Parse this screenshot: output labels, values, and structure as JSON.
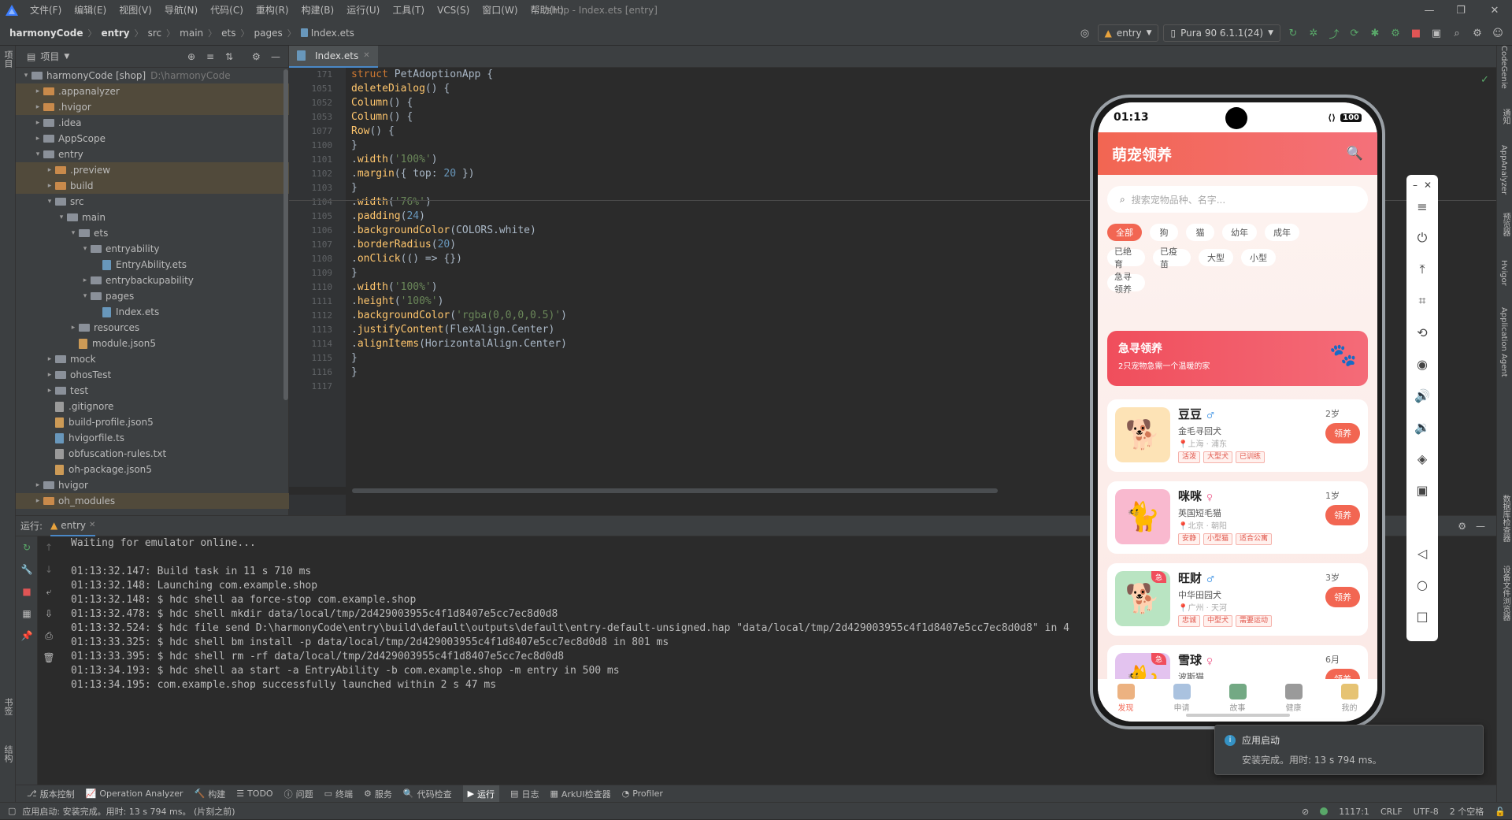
{
  "menu": [
    "文件(F)",
    "编辑(E)",
    "视图(V)",
    "导航(N)",
    "代码(C)",
    "重构(R)",
    "构建(B)",
    "运行(U)",
    "工具(T)",
    "VCS(S)",
    "窗口(W)",
    "帮助(H)"
  ],
  "window_title": "shop - Index.ets [entry]",
  "breadcrumb": [
    "harmonyCode",
    "entry",
    "src",
    "main",
    "ets",
    "pages",
    "Index.ets"
  ],
  "toolbar": {
    "config": "entry",
    "device": "Pura 90 6.1.1(24)"
  },
  "project": {
    "header": "项目",
    "rows": [
      {
        "indent": 0,
        "arrow": "▾",
        "type": "folder",
        "name": "harmonyCode [shop]",
        "extra": "D:\\harmonyCode",
        "sel": false
      },
      {
        "indent": 1,
        "arrow": "▸",
        "type": "folder-o",
        "name": ".appanalyzer",
        "sel": true
      },
      {
        "indent": 1,
        "arrow": "▸",
        "type": "folder-o",
        "name": ".hvigor",
        "sel": true
      },
      {
        "indent": 1,
        "arrow": "▸",
        "type": "folder",
        "name": ".idea",
        "sel": false
      },
      {
        "indent": 1,
        "arrow": "▸",
        "type": "folder",
        "name": "AppScope",
        "sel": false
      },
      {
        "indent": 1,
        "arrow": "▾",
        "type": "folder",
        "name": "entry",
        "sel": false
      },
      {
        "indent": 2,
        "arrow": "▸",
        "type": "folder-o",
        "name": ".preview",
        "sel": true
      },
      {
        "indent": 2,
        "arrow": "▸",
        "type": "folder-o",
        "name": "build",
        "sel": true
      },
      {
        "indent": 2,
        "arrow": "▾",
        "type": "folder",
        "name": "src",
        "sel": false
      },
      {
        "indent": 3,
        "arrow": "▾",
        "type": "folder",
        "name": "main",
        "sel": false
      },
      {
        "indent": 4,
        "arrow": "▾",
        "type": "folder",
        "name": "ets",
        "sel": false
      },
      {
        "indent": 5,
        "arrow": "▾",
        "type": "folder",
        "name": "entryability",
        "sel": false
      },
      {
        "indent": 6,
        "arrow": "",
        "type": "ets",
        "name": "EntryAbility.ets",
        "sel": false
      },
      {
        "indent": 5,
        "arrow": "▸",
        "type": "folder",
        "name": "entrybackupability",
        "sel": false
      },
      {
        "indent": 5,
        "arrow": "▾",
        "type": "folder",
        "name": "pages",
        "sel": false
      },
      {
        "indent": 6,
        "arrow": "",
        "type": "ets",
        "name": "Index.ets",
        "sel": false
      },
      {
        "indent": 4,
        "arrow": "▸",
        "type": "folder",
        "name": "resources",
        "sel": false
      },
      {
        "indent": 4,
        "arrow": "",
        "type": "json",
        "name": "module.json5",
        "sel": false
      },
      {
        "indent": 2,
        "arrow": "▸",
        "type": "folder",
        "name": "mock",
        "sel": false
      },
      {
        "indent": 2,
        "arrow": "▸",
        "type": "folder",
        "name": "ohosTest",
        "sel": false
      },
      {
        "indent": 2,
        "arrow": "▸",
        "type": "folder",
        "name": "test",
        "sel": false
      },
      {
        "indent": 2,
        "arrow": "",
        "type": "txt",
        "name": ".gitignore",
        "sel": false
      },
      {
        "indent": 2,
        "arrow": "",
        "type": "json",
        "name": "build-profile.json5",
        "sel": false
      },
      {
        "indent": 2,
        "arrow": "",
        "type": "ets",
        "name": "hvigorfile.ts",
        "sel": false
      },
      {
        "indent": 2,
        "arrow": "",
        "type": "txt",
        "name": "obfuscation-rules.txt",
        "sel": false
      },
      {
        "indent": 2,
        "arrow": "",
        "type": "json",
        "name": "oh-package.json5",
        "sel": false
      },
      {
        "indent": 1,
        "arrow": "▸",
        "type": "folder",
        "name": "hvigor",
        "sel": false
      },
      {
        "indent": 1,
        "arrow": "▸",
        "type": "folder-o",
        "name": "oh_modules",
        "sel": true
      }
    ]
  },
  "editor": {
    "tab": "Index.ets",
    "lines": [
      {
        "n": "171",
        "html": "<span class='kw'>struct </span><span class='cls'>PetAdoptionApp </span><span class='tx'>{</span>"
      },
      {
        "n": "1051",
        "html": "  <span class='fn'>deleteDialog</span><span class='tx'>() {</span>"
      },
      {
        "n": "1052",
        "html": "    <span class='fn'>Column</span><span class='tx'>() {</span>"
      },
      {
        "n": "1053",
        "html": "      <span class='fn'>Column</span><span class='tx'>() {</span>"
      },
      {
        "n": "1077",
        "html": "        <span class='fn'>Row</span><span class='tx'>() {</span>"
      },
      {
        "n": "1100",
        "html": "        <span class='tx'>}</span>"
      },
      {
        "n": "1101",
        "html": "        <span class='tx'>.</span><span class='fn'>width</span><span class='tx'>(</span><span class='str'>'100%'</span><span class='tx'>)</span>"
      },
      {
        "n": "1102",
        "html": "        <span class='tx'>.</span><span class='fn'>margin</span><span class='tx'>({ </span><span class='tx'>top</span><span class='tx'>: </span><span class='num'>20</span><span class='tx'> })</span>"
      },
      {
        "n": "1103",
        "html": "      <span class='tx'>}</span>"
      },
      {
        "n": "1104",
        "html": "      <span class='tx'>.</span><span class='fn'>width</span><span class='tx'>(</span><span class='str'>'76%'</span><span class='tx'>)</span>"
      },
      {
        "n": "1105",
        "html": "      <span class='tx'>.</span><span class='fn'>padding</span><span class='tx'>(</span><span class='num'>24</span><span class='tx'>)</span>"
      },
      {
        "n": "1106",
        "html": "      <span class='tx'>.</span><span class='fn'>backgroundColor</span><span class='tx'>(COLORS.white)</span>"
      },
      {
        "n": "1107",
        "html": "      <span class='tx'>.</span><span class='fn'>borderRadius</span><span class='tx'>(</span><span class='num'>20</span><span class='tx'>)</span>"
      },
      {
        "n": "1108",
        "html": "      <span class='tx'>.</span><span class='fn'>onClick</span><span class='tx'>(() => {})</span>"
      },
      {
        "n": "1109",
        "html": "    <span class='tx'>}</span>"
      },
      {
        "n": "1110",
        "html": "    <span class='tx'>.</span><span class='fn'>width</span><span class='tx'>(</span><span class='str'>'100%'</span><span class='tx'>)</span>"
      },
      {
        "n": "1111",
        "html": "    <span class='tx'>.</span><span class='fn'>height</span><span class='tx'>(</span><span class='str'>'100%'</span><span class='tx'>)</span>"
      },
      {
        "n": "1112",
        "html": "    <span class='tx'>.</span><span class='fn'>backgroundColor</span><span class='tx'>(</span><span class='str'>'rgba(0,0,0,0.5)'</span><span class='tx'>)</span>"
      },
      {
        "n": "1113",
        "html": "    <span class='tx'>.</span><span class='fn'>justifyContent</span><span class='tx'>(FlexAlign.Center)</span>"
      },
      {
        "n": "1114",
        "html": "    <span class='tx'>.</span><span class='fn'>alignItems</span><span class='tx'>(HorizontalAlign.Center)</span>"
      },
      {
        "n": "1115",
        "html": "  <span class='tx'>}</span>"
      },
      {
        "n": "1116",
        "html": "<span class='tx'>}</span>"
      },
      {
        "n": "1117",
        "html": ""
      }
    ]
  },
  "run": {
    "label": "运行:",
    "tab": "entry",
    "log": [
      "Waiting for emulator online...",
      "",
      "01:13:32.147: Build task in 11 s 710 ms",
      "01:13:32.148: Launching com.example.shop",
      "01:13:32.148: $ hdc shell aa force-stop com.example.shop",
      "01:13:32.478: $ hdc shell mkdir data/local/tmp/2d429003955c4f1d8407e5cc7ec8d0d8",
      "01:13:32.524: $ hdc file send D:\\harmonyCode\\entry\\build\\default\\outputs\\default\\entry-default-unsigned.hap \"data/local/tmp/2d429003955c4f1d8407e5cc7ec8d0d8\" in 4",
      "01:13:33.325: $ hdc shell bm install -p data/local/tmp/2d429003955c4f1d8407e5cc7ec8d0d8 in 801 ms",
      "01:13:33.395: $ hdc shell rm -rf data/local/tmp/2d429003955c4f1d8407e5cc7ec8d0d8",
      "01:13:34.193: $ hdc shell aa start -a EntryAbility -b com.example.shop -m entry in 500 ms",
      "01:13:34.195: com.example.shop successfully launched within 2 s 47 ms"
    ]
  },
  "bottom_tools": [
    "版本控制",
    "Operation Analyzer",
    "构建",
    "TODO",
    "问题",
    "终端",
    "服务",
    "代码检查",
    "运行",
    "日志",
    "ArkUI检查器",
    "Profiler"
  ],
  "left_strip": [
    "项目",
    "书签",
    "结构"
  ],
  "right_strip": [
    "CodeGenie",
    "通知",
    "AppAnalyzer",
    "预览器",
    "Hvigor",
    "Application Agent",
    "数据库检查器",
    "设备文件浏览器"
  ],
  "status": {
    "left": "应用启动: 安装完成。用时: 13 s 794 ms。 (片刻之前)",
    "pos": "1117:1",
    "eol": "CRLF",
    "enc": "UTF-8",
    "indent": "2 个空格"
  },
  "toast": {
    "title": "应用启动",
    "body": "安装完成。用时: 13 s 794 ms。"
  },
  "phone": {
    "time": "01:13",
    "battery": "100",
    "app_title": "萌宠领养",
    "search_placeholder": "搜索宠物品种、名字...",
    "chips_row1": [
      "全部",
      "狗",
      "猫",
      "幼年",
      "成年"
    ],
    "chips_row2": [
      "已绝育",
      "已疫苗",
      "大型",
      "小型"
    ],
    "chips_row3": [
      "急寻领养"
    ],
    "urgent_title": "急寻领养",
    "urgent_sub": "2只宠物急需一个温暖的家",
    "adopt_label": "领养",
    "pets": [
      {
        "name": "豆豆",
        "sex": "♂",
        "breed": "金毛寻回犬",
        "loc": "上海 · 浦东",
        "age": "2岁",
        "tags": [
          "活泼",
          "大型犬",
          "已训练"
        ],
        "bg": "#fde3b6",
        "emoji": "🐕",
        "badge": ""
      },
      {
        "name": "咪咪",
        "sex": "♀",
        "breed": "英国短毛猫",
        "loc": "北京 · 朝阳",
        "age": "1岁",
        "tags": [
          "安静",
          "小型猫",
          "适合公寓"
        ],
        "bg": "#f9b9cf",
        "emoji": "🐈",
        "badge": ""
      },
      {
        "name": "旺财",
        "sex": "♂",
        "breed": "中华田园犬",
        "loc": "广州 · 天河",
        "age": "3岁",
        "tags": [
          "忠诚",
          "中型犬",
          "需要运动"
        ],
        "bg": "#b9e4c2",
        "emoji": "🐕",
        "badge": "急"
      },
      {
        "name": "雪球",
        "sex": "♀",
        "breed": "波斯猫",
        "loc": "",
        "age": "6月",
        "tags": [],
        "bg": "#e3c3ef",
        "emoji": "🐈",
        "badge": "急"
      }
    ],
    "tabs": [
      "发现",
      "申请",
      "故事",
      "健康",
      "我的"
    ],
    "accent": "#f26652"
  }
}
